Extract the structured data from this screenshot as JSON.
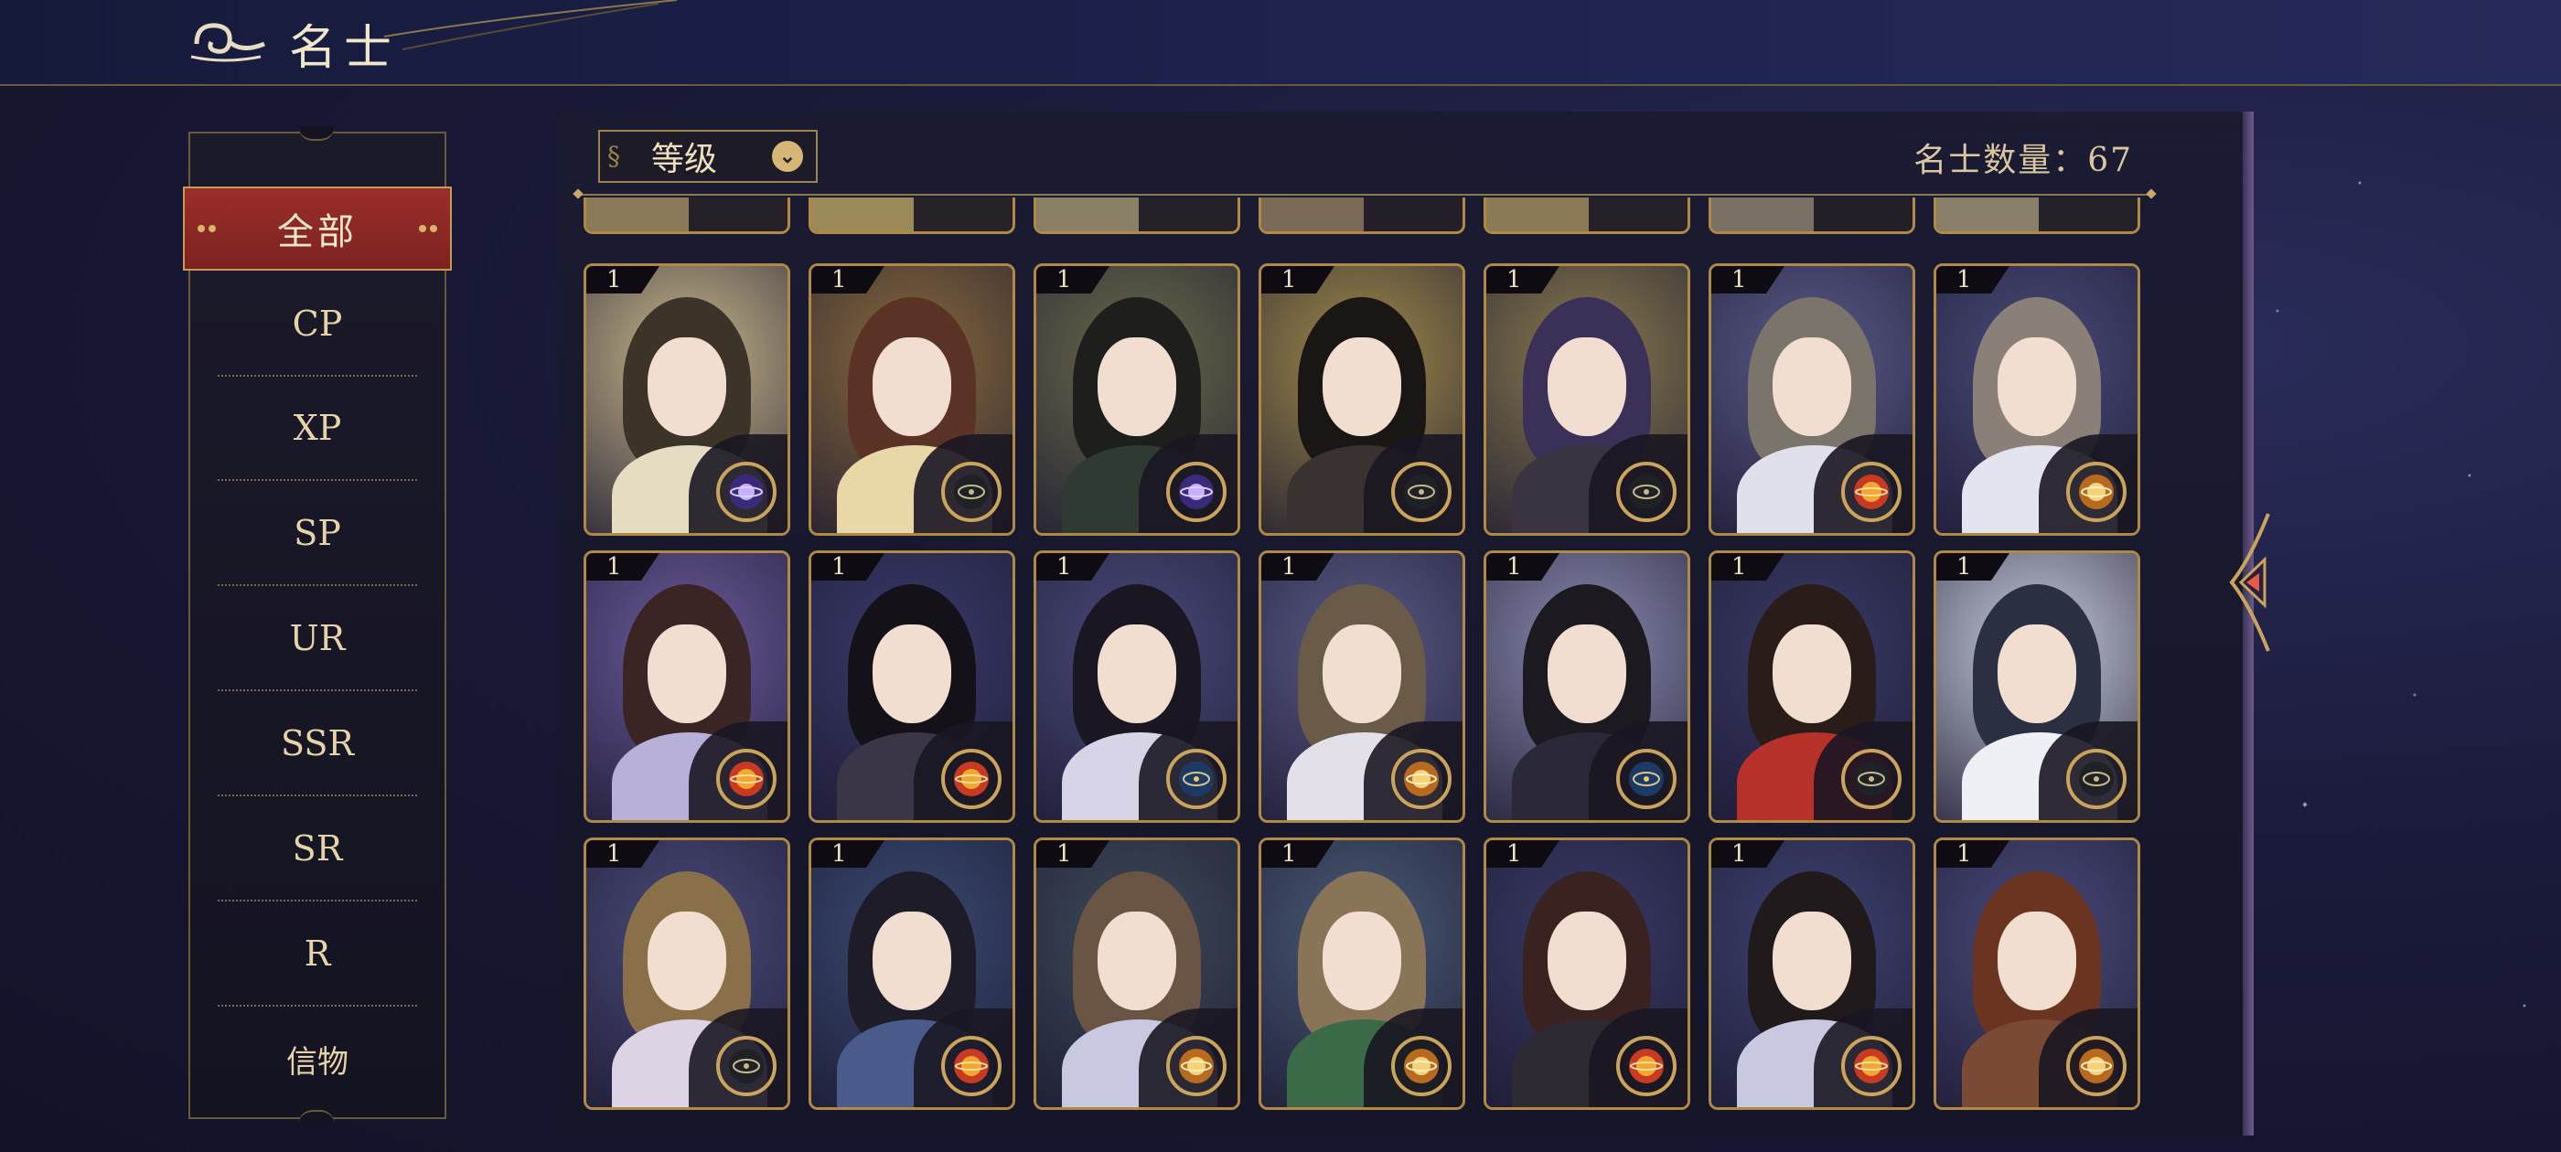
{
  "header": {
    "title": "名士"
  },
  "sidebar": {
    "active": "全部",
    "items": [
      "CP",
      "XP",
      "SP",
      "UR",
      "SSR",
      "SR",
      "R",
      "信物"
    ]
  },
  "toolbar": {
    "sort_label": "等级",
    "count_text": "名士数量：67"
  },
  "colors": {
    "gold_border": "#b08a45",
    "active_red": "#9a2e2a",
    "panel_bg": "#1a1a30"
  },
  "cards": [
    {
      "level": "1",
      "bg": "#c9b78a",
      "hair": "#3c3428",
      "body": "#e6dcc2",
      "badge": "purple-orb"
    },
    {
      "level": "1",
      "bg": "#8a6a3c",
      "hair": "#5a3226",
      "body": "#e8d8a8",
      "badge": "dark-gear"
    },
    {
      "level": "1",
      "bg": "#6a6a4a",
      "hair": "#1e1e1c",
      "body": "#2e3a32",
      "badge": "purple-orb"
    },
    {
      "level": "1",
      "bg": "#a08a4a",
      "hair": "#1a1614",
      "body": "#3a3230",
      "badge": "dark-gear"
    },
    {
      "level": "1",
      "bg": "#8a7a4e",
      "hair": "#3a3058",
      "body": "#3a3440",
      "badge": "dark-gear"
    },
    {
      "level": "1",
      "bg": "#5a5a88",
      "hair": "#7a746a",
      "body": "#e0e0ea",
      "badge": "sun-orb"
    },
    {
      "level": "1",
      "bg": "#4a4a78",
      "hair": "#8a8078",
      "body": "#e4e4f0",
      "badge": "gold-orb"
    },
    {
      "level": "1",
      "bg": "#6a5a9a",
      "hair": "#3a2424",
      "body": "#b8b0d8",
      "badge": "sun-orb"
    },
    {
      "level": "1",
      "bg": "#3a3a6a",
      "hair": "#141218",
      "body": "#3a3648",
      "badge": "sun-orb"
    },
    {
      "level": "1",
      "bg": "#4a4a7a",
      "hair": "#1a1622",
      "body": "#d8d4e8",
      "badge": "blue-gear"
    },
    {
      "level": "1",
      "bg": "#5a5a86",
      "hair": "#6a5a48",
      "body": "#e4e0ea",
      "badge": "gold-orb"
    },
    {
      "level": "1",
      "bg": "#8a8aae",
      "hair": "#1c1a20",
      "body": "#2a2838",
      "badge": "blue-gear"
    },
    {
      "level": "1",
      "bg": "#3a3a66",
      "hair": "#2a1c18",
      "body": "#b8302a",
      "badge": "dark-gear"
    },
    {
      "level": "1",
      "bg": "#c8ccdc",
      "hair": "#2a3042",
      "body": "#eef0f6",
      "badge": "dark-gear"
    },
    {
      "level": "1",
      "bg": "#4a4a78",
      "hair": "#8a7048",
      "body": "#dcd4e4",
      "badge": "dark-gear"
    },
    {
      "level": "1",
      "bg": "#3a4a72",
      "hair": "#1e1c28",
      "body": "#4a5a8a",
      "badge": "sun-orb"
    },
    {
      "level": "1",
      "bg": "#3e4a58",
      "hair": "#6a5444",
      "body": "#c8c8e0",
      "badge": "gold-orb"
    },
    {
      "level": "1",
      "bg": "#4a5a76",
      "hair": "#8a7458",
      "body": "#3a6a48",
      "badge": "gold-orb"
    },
    {
      "level": "1",
      "bg": "#3a3a66",
      "hair": "#3a2220",
      "body": "#2e2a34",
      "badge": "sun-orb"
    },
    {
      "level": "1",
      "bg": "#3e4270",
      "hair": "#201a1c",
      "body": "#c8c8e0",
      "badge": "sun-orb"
    },
    {
      "level": "1",
      "bg": "#4a4a7a",
      "hair": "#6a3420",
      "body": "#7a4a34",
      "badge": "gold-orb"
    }
  ]
}
